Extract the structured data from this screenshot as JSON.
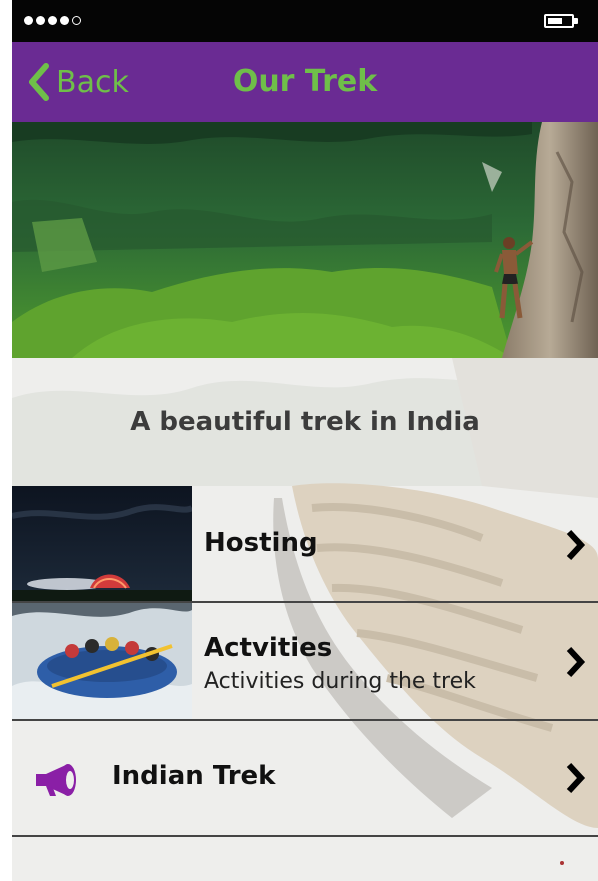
{
  "status_bar": {
    "signal_bars": 4,
    "signal_total": 5
  },
  "nav": {
    "back_label": "Back",
    "title": "Our Trek"
  },
  "hero": {
    "image": "mountain-climber-forest"
  },
  "tagline": "A beautiful trek in India",
  "rows": [
    {
      "title": "Hosting",
      "subtitle": ""
    },
    {
      "title": "Actvities",
      "subtitle": "Activities during the trek"
    },
    {
      "title": "Indian Trek",
      "subtitle": ""
    }
  ],
  "icons": {
    "back": "chevron-left-icon",
    "row_chevron": "chevron-right-icon",
    "indian_trek": "megaphone-icon"
  },
  "colors": {
    "nav_background": "#6a2b93",
    "nav_text": "#6fbf49",
    "status_bar": "#050505",
    "megaphone": "#8a1fa6"
  }
}
